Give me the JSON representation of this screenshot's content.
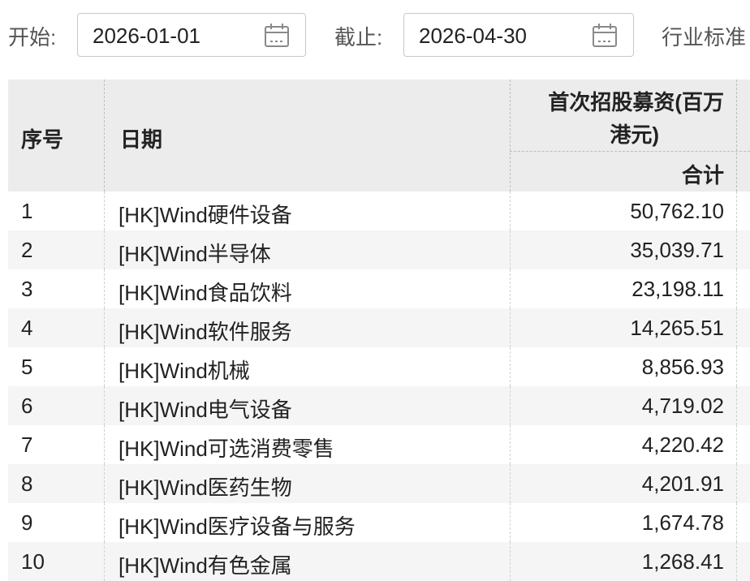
{
  "filters": {
    "start_label": "开始:",
    "start_value": "2026-01-01",
    "end_label": "截止:",
    "end_value": "2026-04-30",
    "industry_label": "行业标准"
  },
  "table": {
    "headers": {
      "index": "序号",
      "date": "日期",
      "ipo_line1": "首次招股募资(百万",
      "ipo_line2": "港元)",
      "total": "合计"
    },
    "rows": [
      {
        "idx": "1",
        "name": "[HK]Wind硬件设备",
        "value": "50,762.10"
      },
      {
        "idx": "2",
        "name": "[HK]Wind半导体",
        "value": "35,039.71"
      },
      {
        "idx": "3",
        "name": "[HK]Wind食品饮料",
        "value": "23,198.11"
      },
      {
        "idx": "4",
        "name": "[HK]Wind软件服务",
        "value": "14,265.51"
      },
      {
        "idx": "5",
        "name": "[HK]Wind机械",
        "value": "8,856.93"
      },
      {
        "idx": "6",
        "name": "[HK]Wind电气设备",
        "value": "4,719.02"
      },
      {
        "idx": "7",
        "name": "[HK]Wind可选消费零售",
        "value": "4,220.42"
      },
      {
        "idx": "8",
        "name": "[HK]Wind医药生物",
        "value": "4,201.91"
      },
      {
        "idx": "9",
        "name": "[HK]Wind医疗设备与服务",
        "value": "1,674.78"
      },
      {
        "idx": "10",
        "name": "[HK]Wind有色金属",
        "value": "1,268.41"
      }
    ]
  },
  "icons": {
    "start_calendar": "calendar-icon",
    "end_calendar": "calendar-icon"
  }
}
